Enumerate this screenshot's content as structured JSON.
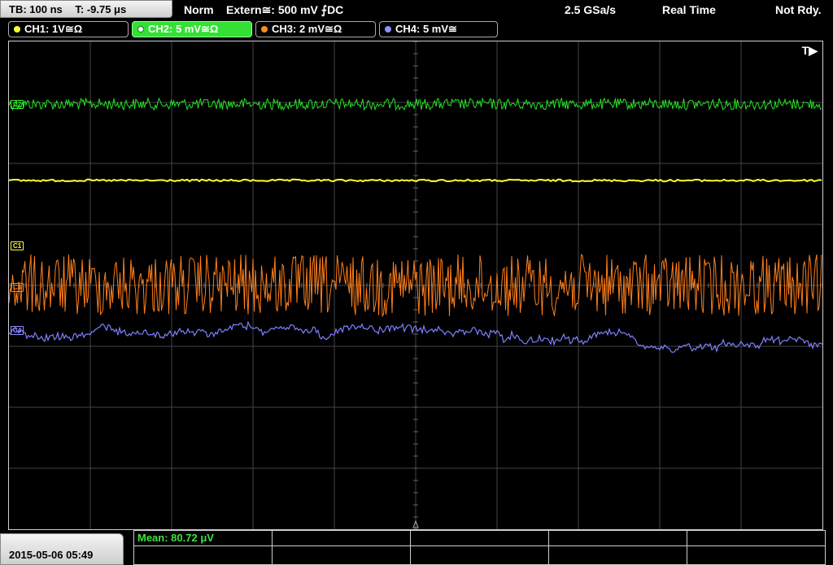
{
  "header": {
    "timebase": "TB: 100 ns",
    "trigger_time": "T: -9.75 μs",
    "mode": "Norm",
    "trigger": "Extern≅: 500 mV ⨍DC",
    "sample_rate": "2.5 GSa/s",
    "acq_mode": "Real Time",
    "status": "Not Rdy."
  },
  "channels": [
    {
      "label": "CH1: 1V≅Ω",
      "color": "#ffff33",
      "active": false
    },
    {
      "label": "CH2: 5 mV≅Ω",
      "color": "#33ee33",
      "active": true
    },
    {
      "label": "CH3: 2 mV≅Ω",
      "color": "#ff8a1e",
      "active": false
    },
    {
      "label": "CH4: 5 mV≅",
      "color": "#8f8fff",
      "active": false
    }
  ],
  "markers": {
    "trigger": "T▶",
    "c1": "C1",
    "c2": "C2",
    "c3": "C3",
    "c4": "C4"
  },
  "footer": {
    "datetime": "2015-05-06 05:49",
    "measurement": "Mean: 80.72 μV"
  },
  "colors": {
    "ch1": "#ffff33",
    "ch2": "#22e622",
    "ch3": "#ff7f1a",
    "ch4": "#7f7fff",
    "grid": "#444444"
  }
}
